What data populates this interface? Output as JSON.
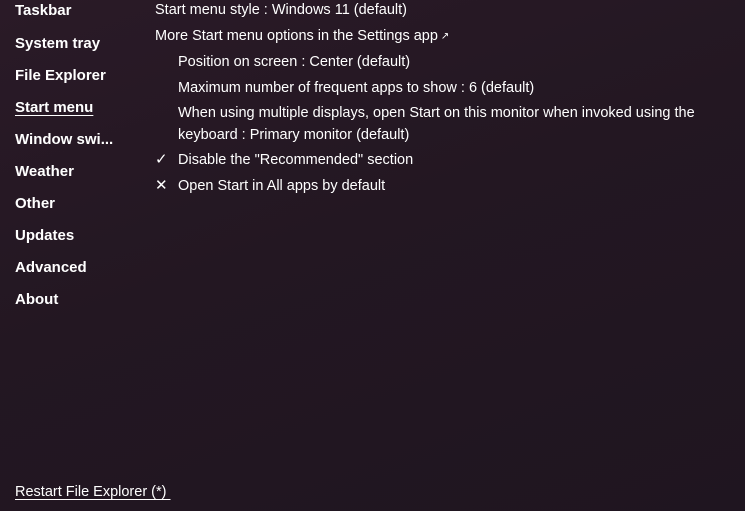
{
  "sidebar": {
    "items": [
      {
        "label": "Taskbar"
      },
      {
        "label": "System tray"
      },
      {
        "label": "File Explorer"
      },
      {
        "label": "Start menu"
      },
      {
        "label": "Window swi..."
      },
      {
        "label": "Weather"
      },
      {
        "label": "Other"
      },
      {
        "label": "Updates"
      },
      {
        "label": "Advanced"
      },
      {
        "label": "About"
      }
    ],
    "active": "Start menu",
    "restart_link": "Restart File Explorer (*) "
  },
  "start_menu": {
    "style_setting": "Start menu style : Windows 11 (default)",
    "more_options_link": "More Start menu options in the Settings app",
    "external_link_icon": "external-link-icon",
    "position_setting": "Position on screen : Center (default)",
    "frequent_apps_setting": "Maximum number of frequent apps to show : 6 (default)",
    "multi_display_setting": "When using multiple displays, open Start on this monitor when invoked using the keyboard : Primary monitor (default)",
    "disable_recommended": {
      "label": "Disable the \"Recommended\" section",
      "checked": true,
      "mark": "✓"
    },
    "open_all_apps": {
      "label": "Open Start in All apps by default",
      "checked": false,
      "mark": "✕"
    }
  }
}
